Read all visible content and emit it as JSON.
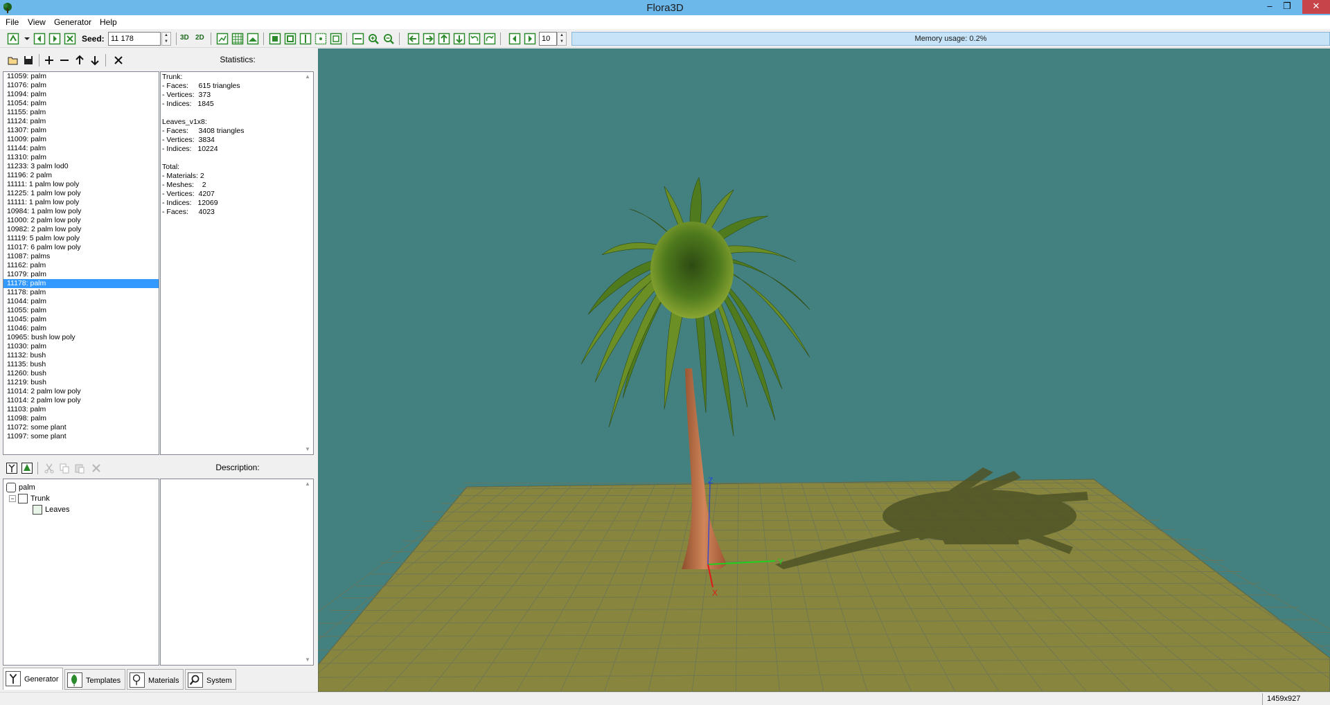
{
  "window": {
    "title": "Flora3D",
    "minimize": "–",
    "restore": "❐",
    "close": "✕"
  },
  "menu": [
    "File",
    "View",
    "Generator",
    "Help"
  ],
  "toolbar": {
    "seed_label": "Seed:",
    "seed_value": "11 178",
    "view_3d": "3D",
    "view_2d": "2D",
    "level_value": "10",
    "memory_usage": "Memory usage: 0.2%"
  },
  "plants": {
    "items": [
      "11059: palm",
      "11076: palm",
      "11094: palm",
      "11054: palm",
      "11155: palm",
      "11124: palm",
      "11307: palm",
      "11009: palm",
      "11144: palm",
      "11310: palm",
      "11233: 3 palm lod0",
      "11196: 2 palm",
      "11111: 1 palm low poly",
      "11225: 1 palm low poly",
      "11111: 1 palm low poly",
      "10984: 1 palm low poly",
      "11000: 2 palm low poly",
      "10982: 2 palm low poly",
      "11119: 5 palm low poly",
      "11017: 6 palm low poly",
      "11087: palms",
      "11162: palm",
      "11079: palm",
      "11178: palm",
      "11178: palm",
      "11044: palm",
      "11055: palm",
      "11045: palm",
      "11046: palm",
      "10965: bush low poly",
      "11030: palm",
      "11132: bush",
      "11135: bush",
      "11260: bush",
      "11219: bush",
      "11014: 2 palm low poly",
      "11014: 2 palm low poly",
      "11103: palm",
      "11098: palm",
      "11072: some plant",
      "11097: some plant"
    ],
    "selected_index": 23
  },
  "statistics": {
    "header": "Statistics:",
    "lines": [
      "Trunk:",
      "- Faces:     615 triangles",
      "- Vertices:  373",
      "- Indices:   1845",
      "",
      "Leaves_v1x8:",
      "- Faces:     3408 triangles",
      "- Vertices:  3834",
      "- Indices:   10224",
      "",
      "Total:",
      "- Materials: 2",
      "- Meshes:    2",
      "- Vertices:  4207",
      "- Indices:   12069",
      "- Faces:     4023"
    ]
  },
  "tree": {
    "root": "palm",
    "trunk": "Trunk",
    "leaves": "Leaves",
    "collapse_glyph": "−"
  },
  "description": {
    "header": "Description:"
  },
  "tabs": [
    {
      "label": "Generator",
      "icon": "generator-icon",
      "active": true
    },
    {
      "label": "Templates",
      "icon": "templates-icon",
      "active": false
    },
    {
      "label": "Materials",
      "icon": "materials-icon",
      "active": false
    },
    {
      "label": "System",
      "icon": "system-icon",
      "active": false
    }
  ],
  "viewport": {
    "axis_x": "X",
    "axis_y": "Y",
    "axis_z": "Z",
    "background": "#438180",
    "ground": "#87853e",
    "trunk": "#c97748",
    "foliage": "#4f7a1d"
  },
  "status": {
    "size": "1459x927"
  },
  "colors": {
    "titlebar": "#6db8ea",
    "selection": "#3399ff",
    "memory_bar": "#c6e3f7",
    "icon_green": "#2c8a2c"
  }
}
